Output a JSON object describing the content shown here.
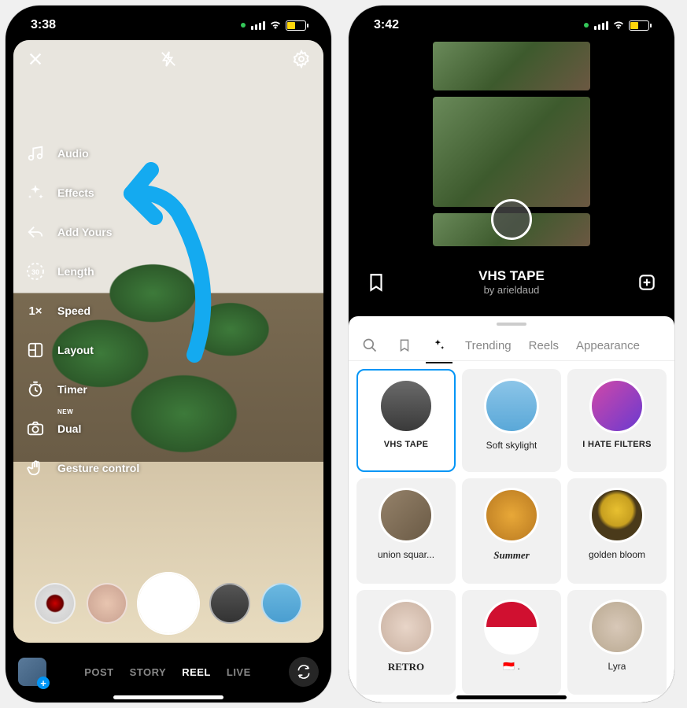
{
  "phone1": {
    "status": {
      "time": "3:38"
    },
    "controls": [
      {
        "id": "audio",
        "label": "Audio",
        "icon": "music-icon"
      },
      {
        "id": "effects",
        "label": "Effects",
        "icon": "sparkle-icon"
      },
      {
        "id": "add-yours",
        "label": "Add Yours",
        "icon": "reply-icon"
      },
      {
        "id": "length",
        "label": "Length",
        "icon": "duration-30-icon"
      },
      {
        "id": "speed",
        "label": "Speed",
        "icon": "speed-1x-icon"
      },
      {
        "id": "layout",
        "label": "Layout",
        "icon": "layout-icon"
      },
      {
        "id": "timer",
        "label": "Timer",
        "icon": "timer-icon"
      },
      {
        "id": "dual",
        "label": "Dual",
        "icon": "camera-icon",
        "badge": "NEW"
      },
      {
        "id": "gesture",
        "label": "Gesture control",
        "icon": "hand-icon"
      }
    ],
    "speed_indicator": "1×",
    "length_indicator": "30",
    "modes": [
      {
        "label": "POST",
        "active": false
      },
      {
        "label": "STORY",
        "active": false
      },
      {
        "label": "REEL",
        "active": true
      },
      {
        "label": "LIVE",
        "active": false
      }
    ]
  },
  "phone2": {
    "status": {
      "time": "3:42"
    },
    "current_effect": {
      "name": "VHS TAPE",
      "author": "by arieldaud"
    },
    "tabs": [
      {
        "id": "search",
        "type": "icon"
      },
      {
        "id": "saved",
        "type": "icon"
      },
      {
        "id": "sparkle",
        "type": "icon",
        "active": true
      },
      {
        "id": "trending",
        "label": "Trending"
      },
      {
        "id": "reels",
        "label": "Reels"
      },
      {
        "id": "appearance",
        "label": "Appearance"
      }
    ],
    "effects": [
      {
        "id": "vhs-tape",
        "label": "VHS TAPE",
        "style": "upper",
        "thumb": "ec-vhs",
        "selected": true
      },
      {
        "id": "soft-skylight",
        "label": "Soft skylight",
        "style": "",
        "thumb": "ec-sky"
      },
      {
        "id": "i-hate-filters",
        "label": "I HATE FILTERS",
        "style": "upper",
        "thumb": "ec-hate"
      },
      {
        "id": "union-square",
        "label": "union squar...",
        "style": "",
        "thumb": "ec-union"
      },
      {
        "id": "summer",
        "label": "Summer",
        "style": "serif",
        "thumb": "ec-summer"
      },
      {
        "id": "golden-bloom",
        "label": "golden bloom",
        "style": "",
        "thumb": "ec-golden"
      },
      {
        "id": "retro",
        "label": "RETRO",
        "style": "retro",
        "thumb": "ec-retro"
      },
      {
        "id": "flag",
        "label": "🇮🇩 .",
        "style": "",
        "thumb": "ec-flag"
      },
      {
        "id": "lyra",
        "label": "Lyra",
        "style": "",
        "thumb": "ec-lyra"
      }
    ]
  }
}
